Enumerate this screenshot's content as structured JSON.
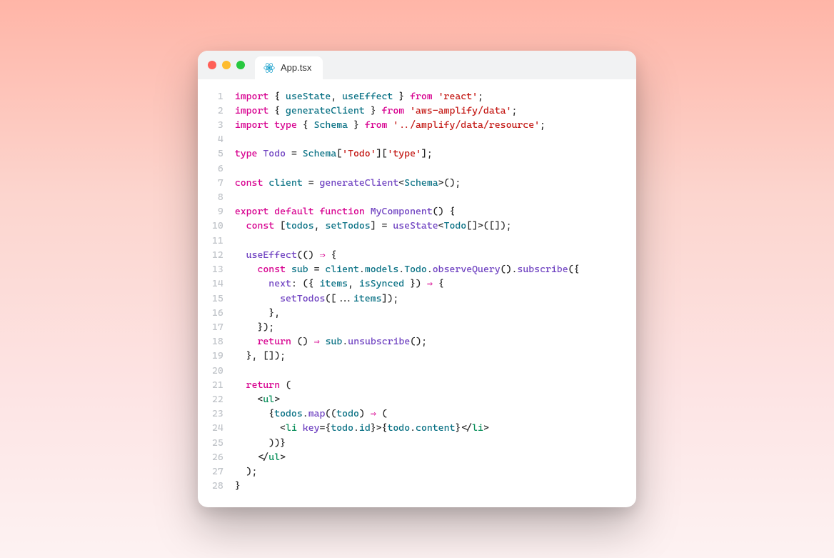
{
  "tab": {
    "filename": "App.tsx"
  },
  "icons": {
    "react": "react-icon"
  },
  "traffic": {
    "red": "#ff5f57",
    "yellow": "#febc2e",
    "green": "#28c840"
  },
  "lineNumbers": "1\n2\n3\n4\n5\n6\n7\n8\n9\n10\n11\n12\n13\n14\n15\n16\n17\n18\n19\n20\n21\n22\n23\n24\n25\n26\n27\n28",
  "code": {
    "raw": "import { useState, useEffect } from 'react';\nimport { generateClient } from 'aws-amplify/data';\nimport type { Schema } from '../amplify/data/resource';\n\ntype Todo = Schema['Todo']['type'];\n\nconst client = generateClient<Schema>();\n\nexport default function MyComponent() {\n  const [todos, setTodos] = useState<Todo[]>([]);\n\n  useEffect(() => {\n    const sub = client.models.Todo.observeQuery().subscribe({\n      next: ({ items, isSynced }) => {\n        setTodos([...items]);\n      },\n    });\n    return () => sub.unsubscribe();\n  }, []);\n\n  return (\n    <ul>\n      {todos.map((todo) => (\n        <li key={todo.id}>{todo.content}</li>\n      ))}\n    </ul>\n  );\n}",
    "l1": {
      "a": "import",
      "b": " { ",
      "c": "useState",
      "d": ", ",
      "e": "useEffect",
      "f": " } ",
      "g": "from",
      "h": " ",
      "i": "'react'",
      "j": ";"
    },
    "l2": {
      "a": "import",
      "b": " { ",
      "c": "generateClient",
      "d": " } ",
      "e": "from",
      "f": " ",
      "g": "'aws-amplify/data'",
      "h": ";"
    },
    "l3": {
      "a": "import",
      "b": " ",
      "c": "type",
      "d": " { ",
      "e": "Schema",
      "f": " } ",
      "g": "from",
      "h": " ",
      "i": "'../amplify/data/resource'",
      "j": ";"
    },
    "l4": {
      "a": ""
    },
    "l5": {
      "a": "type",
      "b": " ",
      "c": "Todo",
      "d": " = ",
      "e": "Schema",
      "f": "[",
      "g": "'Todo'",
      "h": "][",
      "i": "'type'",
      "j": "];"
    },
    "l6": {
      "a": ""
    },
    "l7": {
      "a": "const",
      "b": " ",
      "c": "client",
      "d": " = ",
      "e": "generateClient",
      "f": "<",
      "g": "Schema",
      "h": ">();"
    },
    "l8": {
      "a": ""
    },
    "l9": {
      "a": "export",
      "b": " ",
      "c": "default",
      "d": " ",
      "e": "function",
      "f": " ",
      "g": "MyComponent",
      "h": "() {"
    },
    "l10": {
      "a": "  ",
      "b": "const",
      "c": " [",
      "d": "todos",
      "e": ", ",
      "f": "setTodos",
      "g": "] = ",
      "h": "useState",
      "i": "<",
      "j": "Todo",
      "k": "[]>([]);"
    },
    "l11": {
      "a": ""
    },
    "l12": {
      "a": "  ",
      "b": "useEffect",
      "c": "(() ",
      "d": "⇒",
      "e": " {"
    },
    "l13": {
      "a": "    ",
      "b": "const",
      "c": " ",
      "d": "sub",
      "e": " = ",
      "f": "client",
      "g": ".",
      "h": "models",
      "i": ".",
      "j": "Todo",
      "k": ".",
      "l": "observeQuery",
      "m": "().",
      "n": "subscribe",
      "o": "({"
    },
    "l14": {
      "a": "      ",
      "b": "next",
      "c": ": ({ ",
      "d": "items",
      "e": ", ",
      "f": "isSynced",
      "g": " }) ",
      "h": "⇒",
      "i": " {"
    },
    "l15": {
      "a": "        ",
      "b": "setTodos",
      "c": "([...",
      "d": "items",
      "e": "]);"
    },
    "l16": {
      "a": "      },"
    },
    "l17": {
      "a": "    });"
    },
    "l18": {
      "a": "    ",
      "b": "return",
      "c": " () ",
      "d": "⇒",
      "e": " ",
      "f": "sub",
      "g": ".",
      "h": "unsubscribe",
      "i": "();"
    },
    "l19": {
      "a": "  }, []);"
    },
    "l20": {
      "a": ""
    },
    "l21": {
      "a": "  ",
      "b": "return",
      "c": " ("
    },
    "l22": {
      "a": "    <",
      "b": "ul",
      "c": ">"
    },
    "l23": {
      "a": "      {",
      "b": "todos",
      "c": ".",
      "d": "map",
      "e": "((",
      "f": "todo",
      "g": ") ",
      "h": "⇒",
      "i": " ("
    },
    "l24": {
      "a": "        <",
      "b": "li",
      "c": " ",
      "d": "key",
      "e": "={",
      "f": "todo",
      "g": ".",
      "h": "id",
      "i": "}>{",
      "j": "todo",
      "k": ".",
      "l": "content",
      "m": "}</",
      "n": "li",
      "o": ">"
    },
    "l25": {
      "a": "      ))}"
    },
    "l26": {
      "a": "    </",
      "b": "ul",
      "c": ">"
    },
    "l27": {
      "a": "  );"
    },
    "l28": {
      "a": "}"
    }
  }
}
